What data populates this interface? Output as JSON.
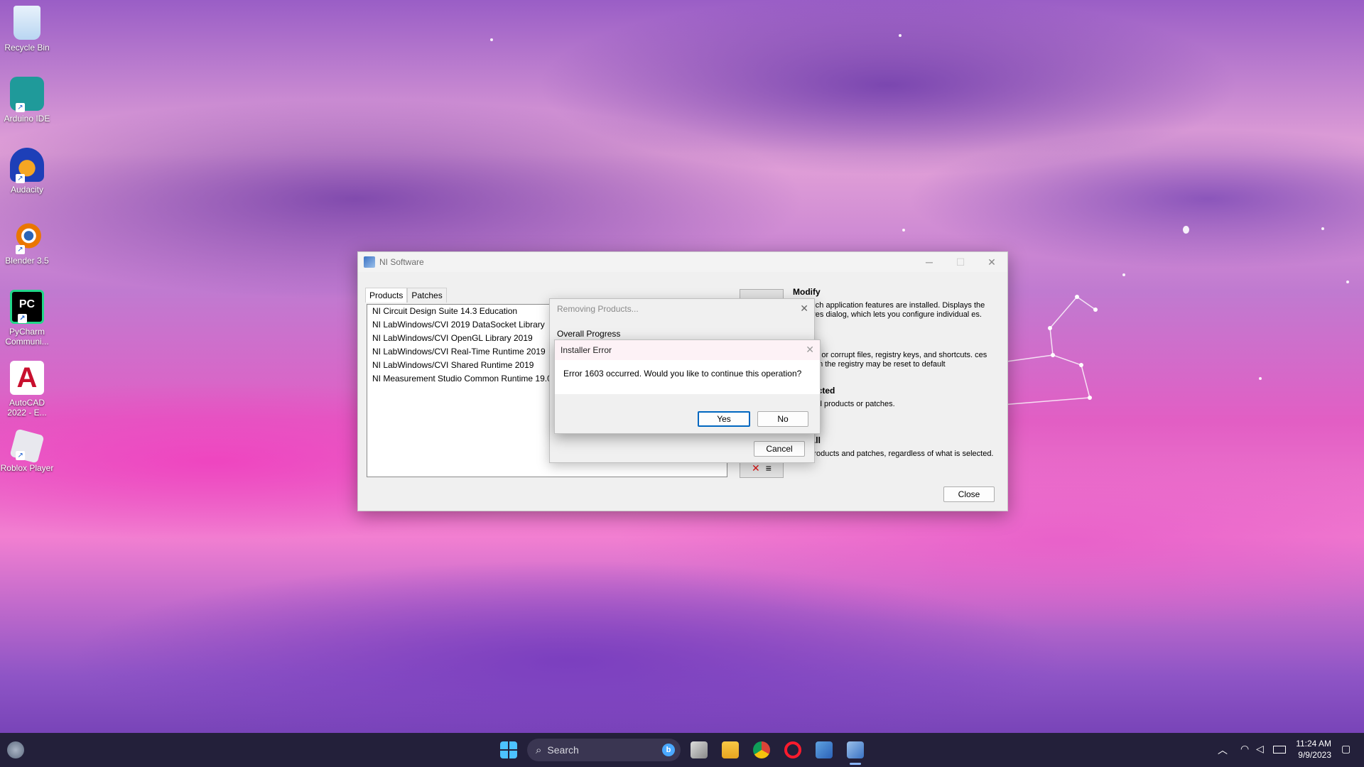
{
  "desktop": {
    "icons": [
      {
        "label": "Recycle Bin"
      },
      {
        "label": "Arduino IDE"
      },
      {
        "label": "Audacity"
      },
      {
        "label": "Blender 3.5"
      },
      {
        "label": "PyCharm Communi..."
      },
      {
        "label": "AutoCAD 2022 - E..."
      },
      {
        "label": "Roblox Player"
      }
    ]
  },
  "main_window": {
    "title": "NI Software",
    "tabs": [
      {
        "label": "Products"
      },
      {
        "label": "Patches"
      }
    ],
    "products": [
      "NI Circuit Design Suite 14.3 Education",
      "NI LabWindows/CVI 2019 DataSocket Library",
      "NI LabWindows/CVI OpenGL Library 2019",
      "NI LabWindows/CVI Real-Time Runtime 2019",
      "NI LabWindows/CVI Shared Runtime 2019",
      "NI Measurement Studio Common Runtime 19.0"
    ],
    "modify_heading": "Modify",
    "modify_text": "ge which application features are installed.  Displays the Features dialog, which lets you configure individual es.",
    "repair_text": "missing or corrupt files, registry keys, and shortcuts. ces stored in the registry may be reset to default",
    "remove_selected_heading": "e Selected",
    "remove_selected_text": "selected products or patches.",
    "remove_all_heading": "ove All",
    "remove_all_text": "e all products and patches, regardless of what is selected.",
    "close_label": "Close"
  },
  "progress_dialog": {
    "title": "Removing Products...",
    "overall_progress_label": "Overall Progress",
    "cancel_label": "Cancel"
  },
  "error_dialog": {
    "title": "Installer Error",
    "message": "Error 1603 occurred.  Would you like to continue this operation?",
    "yes_label": "Yes",
    "no_label": "No"
  },
  "taskbar": {
    "search_placeholder": "Search",
    "time": "11:24 AM",
    "date": "9/9/2023"
  }
}
